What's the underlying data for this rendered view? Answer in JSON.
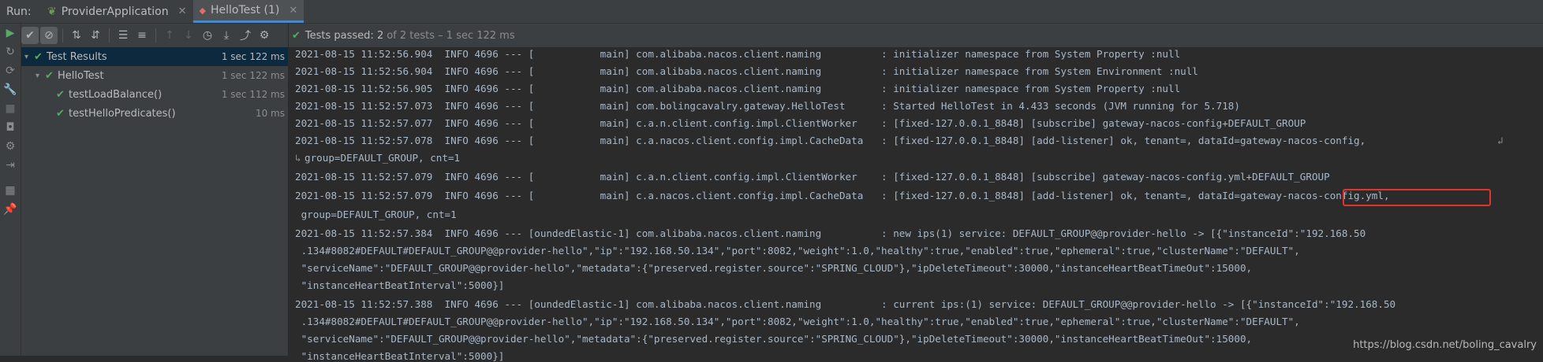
{
  "tabbar": {
    "run_label": "Run:",
    "tabs": [
      {
        "label": "ProviderApplication",
        "active": false
      },
      {
        "label": "HelloTest (1)",
        "active": true
      }
    ]
  },
  "status": {
    "passed": "Tests passed: 2",
    "detail": "of 2 tests – 1 sec 122 ms"
  },
  "tree": [
    {
      "label": "Test Results",
      "duration": "1 sec 122 ms",
      "level": 0,
      "selected": true
    },
    {
      "label": "HelloTest",
      "duration": "1 sec 122 ms",
      "level": 1,
      "selected": false
    },
    {
      "label": "testLoadBalance()",
      "duration": "1 sec 112 ms",
      "level": 2,
      "selected": false
    },
    {
      "label": "testHelloPredicates()",
      "duration": "10 ms",
      "level": 2,
      "selected": false
    }
  ],
  "console_lines": [
    "2021-08-15 11:52:56.904  INFO 4696 --- [           main] com.alibaba.nacos.client.naming          : initializer namespace from System Property :null",
    "2021-08-15 11:52:56.904  INFO 4696 --- [           main] com.alibaba.nacos.client.naming          : initializer namespace from System Environment :null",
    "2021-08-15 11:52:56.905  INFO 4696 --- [           main] com.alibaba.nacos.client.naming          : initializer namespace from System Property :null",
    "2021-08-15 11:52:57.073  INFO 4696 --- [           main] com.bolingcavalry.gateway.HelloTest      : Started HelloTest in 4.433 seconds (JVM running for 5.718)",
    "2021-08-15 11:52:57.077  INFO 4696 --- [           main] c.a.n.client.config.impl.ClientWorker    : [fixed-127.0.0.1_8848] [subscribe] gateway-nacos-config+DEFAULT_GROUP",
    "2021-08-15 11:52:57.078  INFO 4696 --- [           main] c.a.nacos.client.config.impl.CacheData   : [fixed-127.0.0.1_8848] [add-listener] ok, tenant=, dataId=gateway-nacos-config, ",
    "group=DEFAULT_GROUP, cnt=1",
    "2021-08-15 11:52:57.079  INFO 4696 --- [           main] c.a.n.client.config.impl.ClientWorker    : [fixed-127.0.0.1_8848] [subscribe] gateway-nacos-config.yml+DEFAULT_GROUP",
    "2021-08-15 11:52:57.079  INFO 4696 --- [           main] c.a.nacos.client.config.impl.CacheData   : [fixed-127.0.0.1_8848] [add-listener] ok, tenant=, dataId=gateway-nacos-config.yml,",
    " group=DEFAULT_GROUP, cnt=1",
    "2021-08-15 11:52:57.384  INFO 4696 --- [oundedElastic-1] com.alibaba.nacos.client.naming          : new ips(1) service: DEFAULT_GROUP@@provider-hello -> [{\"instanceId\":\"192.168.50",
    " .134#8082#DEFAULT#DEFAULT_GROUP@@provider-hello\",\"ip\":\"192.168.50.134\",\"port\":8082,\"weight\":1.0,\"healthy\":true,\"enabled\":true,\"ephemeral\":true,\"clusterName\":\"DEFAULT\",",
    " \"serviceName\":\"DEFAULT_GROUP@@provider-hello\",\"metadata\":{\"preserved.register.source\":\"SPRING_CLOUD\"},\"ipDeleteTimeout\":30000,\"instanceHeartBeatTimeOut\":15000,",
    " \"instanceHeartBeatInterval\":5000}]",
    "2021-08-15 11:52:57.388  INFO 4696 --- [oundedElastic-1] com.alibaba.nacos.client.naming          : current ips:(1) service: DEFAULT_GROUP@@provider-hello -> [{\"instanceId\":\"192.168.50",
    " .134#8082#DEFAULT#DEFAULT_GROUP@@provider-hello\",\"ip\":\"192.168.50.134\",\"port\":8082,\"weight\":1.0,\"healthy\":true,\"enabled\":true,\"ephemeral\":true,\"clusterName\":\"DEFAULT\",",
    " \"serviceName\":\"DEFAULT_GROUP@@provider-hello\",\"metadata\":{\"preserved.register.source\":\"SPRING_CLOUD\"},\"ipDeleteTimeout\":30000,\"instanceHeartBeatTimeOut\":15000,",
    " \"instanceHeartBeatInterval\":5000}]"
  ],
  "watermark": "https://blog.csdn.net/boling_cavalry",
  "colors": {
    "accent": "#4a88c7",
    "pass": "#59a869",
    "highlight": "#e0342d",
    "selection": "#0d293e"
  }
}
